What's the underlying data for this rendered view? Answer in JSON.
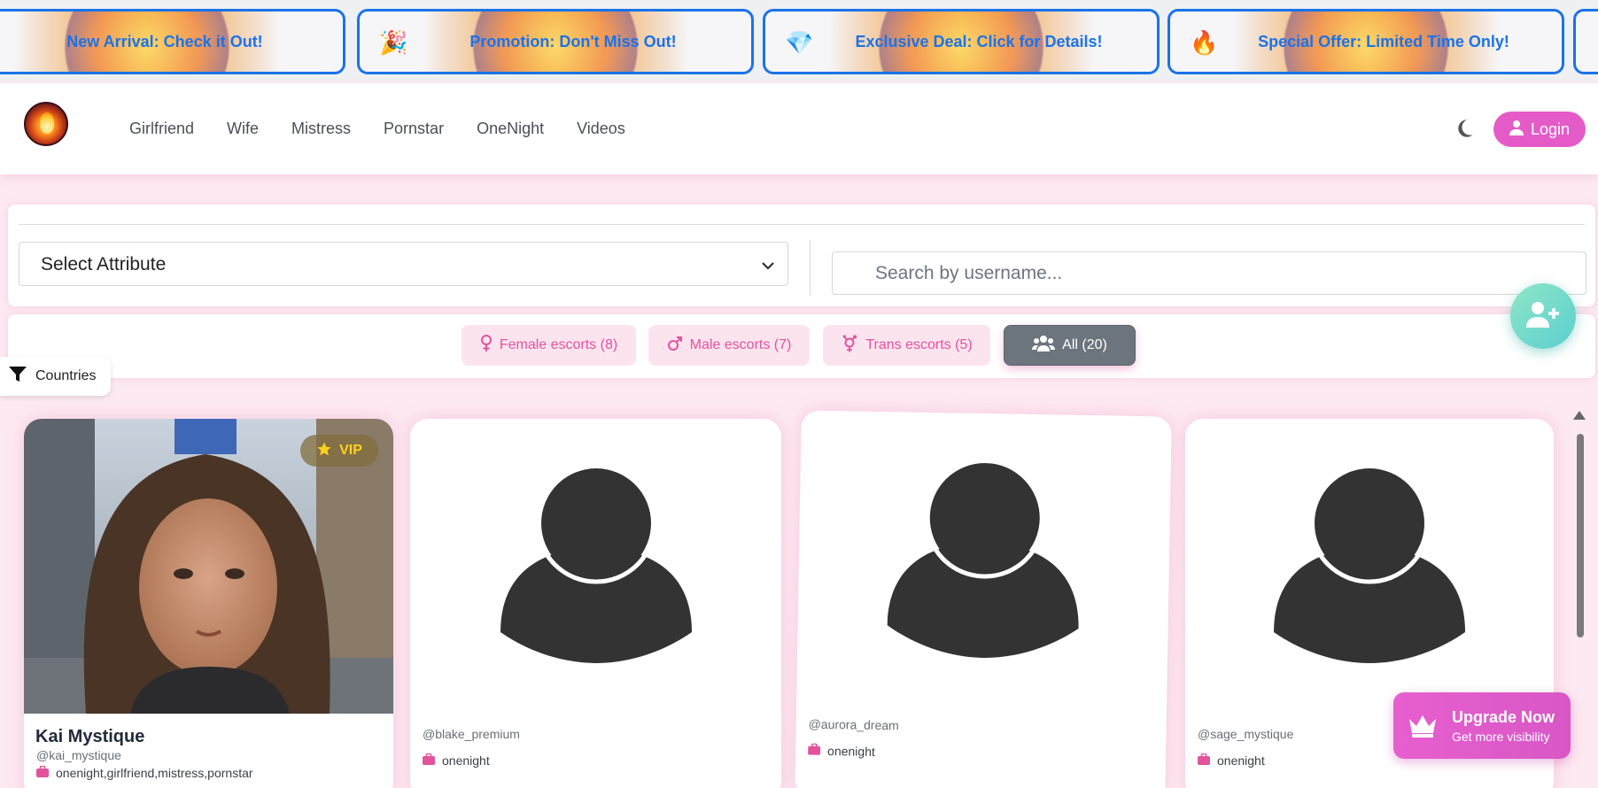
{
  "promos": [
    {
      "emoji": "",
      "text": "New Arrival: Check it Out!"
    },
    {
      "emoji": "🎉",
      "text": "Promotion: Don't Miss Out!"
    },
    {
      "emoji": "💎",
      "text": "Exclusive Deal: Click for Details!"
    },
    {
      "emoji": "🔥",
      "text": "Special Offer: Limited Time Only!"
    }
  ],
  "nav": {
    "links": [
      "Girlfriend",
      "Wife",
      "Mistress",
      "Pornstar",
      "OneNight",
      "Videos"
    ],
    "login_label": "Login"
  },
  "filters": {
    "select_label": "Select Attribute",
    "search_placeholder": "Search by username..."
  },
  "gender_tabs": [
    {
      "label": "Female escorts (8)",
      "icon": "female-icon",
      "active": false
    },
    {
      "label": "Male escorts (7)",
      "icon": "male-icon",
      "active": false
    },
    {
      "label": "Trans escorts (5)",
      "icon": "transgender-icon",
      "active": false
    },
    {
      "label": "All (20)",
      "icon": "users-icon",
      "active": true
    }
  ],
  "countries_label": "Countries",
  "profiles": [
    {
      "name": "Kai Mystique",
      "handle": "@kai_mystique",
      "tags": "onenight,girlfriend,mistress,pornstar",
      "vip": true,
      "vip_label": "VIP",
      "has_photo": true
    },
    {
      "name": "",
      "handle": "@blake_premium",
      "tags": "onenight",
      "vip": false,
      "has_photo": false
    },
    {
      "name": "",
      "handle": "@aurora_dream",
      "tags": "onenight",
      "vip": false,
      "has_photo": false
    },
    {
      "name": "",
      "handle": "@sage_mystique",
      "tags": "onenight",
      "vip": false,
      "has_photo": false
    }
  ],
  "upgrade": {
    "title": "Upgrade Now",
    "subtitle": "Get more visibility"
  },
  "colors": {
    "accent_pink": "#e45bc8",
    "promo_blue": "#1a73e8",
    "tab_pink": "#e2539c",
    "fab_teal": "#5ccfd0"
  }
}
